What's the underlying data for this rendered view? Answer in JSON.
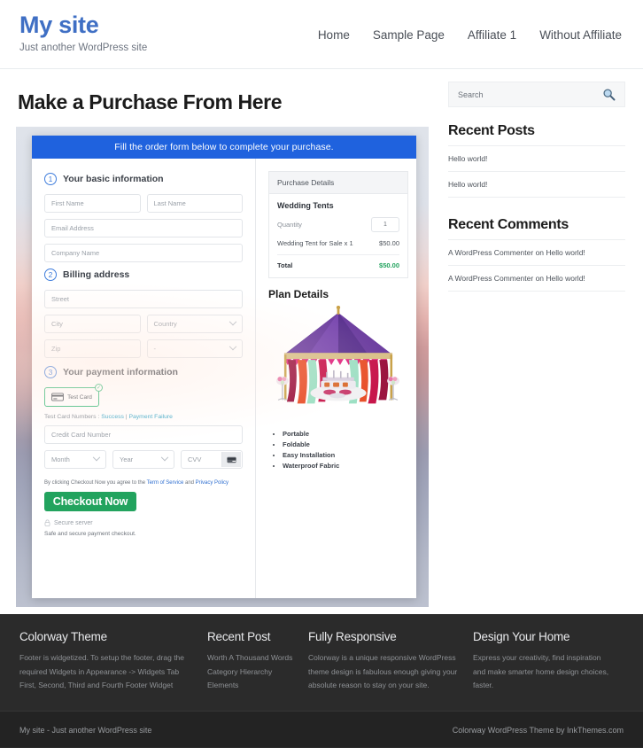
{
  "header": {
    "site_title": "My site",
    "tagline": "Just another WordPress site",
    "nav": [
      {
        "label": "Home"
      },
      {
        "label": "Sample Page"
      },
      {
        "label": "Affiliate 1"
      },
      {
        "label": "Without Affiliate"
      }
    ]
  },
  "main": {
    "page_title": "Make a Purchase From Here",
    "banner": "Fill the order form below to complete your purchase.",
    "steps": {
      "one": {
        "num": "1",
        "label": "Your basic information"
      },
      "two": {
        "num": "2",
        "label": "Billing address"
      },
      "three": {
        "num": "3",
        "label": "Your payment information"
      }
    },
    "fields": {
      "first_name": "First Name",
      "last_name": "Last Name",
      "email": "Email Address",
      "company": "Company Name",
      "street": "Street",
      "city": "City",
      "country": "Country",
      "zip": "Zip",
      "state": "-",
      "credit_card": "Credit Card Number",
      "month": "Month",
      "year": "Year",
      "cvv": "CVV"
    },
    "payment": {
      "card_option_label": "Test Card",
      "card_check_glyph": "✓",
      "testcard_prefix": "Test Card Numbers : ",
      "testcard_success": "Success",
      "testcard_divider": " | ",
      "testcard_failure": "Payment Failure",
      "agree_prefix": "By clicking Checkout Now you agree to the ",
      "agree_tos": "Term of Service",
      "agree_and": " and ",
      "agree_privacy": "Privacy Policy",
      "checkout_label": "Checkout Now",
      "secure_server": "Secure server",
      "safe_note": "Safe and secure payment checkout."
    },
    "purchase": {
      "panel_title": "Purchase Details",
      "product": "Wedding Tents",
      "quantity_label": "Quantity",
      "quantity_value": "1",
      "line_item_label": "Wedding Tent for Sale x 1",
      "line_item_price": "$50.00",
      "total_label": "Total",
      "total_value": "$50.00",
      "total_color": "#22a35e"
    },
    "plan": {
      "title": "Plan Details",
      "features": [
        "Portable",
        "Foldable",
        "Easy Installation",
        "Waterproof Fabric"
      ]
    }
  },
  "sidebar": {
    "search_placeholder": "Search",
    "recent_posts_title": "Recent Posts",
    "recent_posts": [
      {
        "label": "Hello world!"
      },
      {
        "label": "Hello world!"
      }
    ],
    "recent_comments_title": "Recent Comments",
    "recent_comments": [
      {
        "label": "A WordPress Commenter on Hello world!"
      },
      {
        "label": "A WordPress Commenter on Hello world!"
      }
    ]
  },
  "footer": {
    "columns": [
      {
        "title": "Colorway Theme",
        "text": "Footer is widgetized. To setup the footer, drag the required Widgets in Appearance -> Widgets Tab First, Second, Third and Fourth Footer Widget"
      },
      {
        "title": "Recent Post",
        "items": [
          {
            "label": "Worth A Thousand Words"
          },
          {
            "label": "Category Hierarchy"
          },
          {
            "label": "Elements"
          }
        ]
      },
      {
        "title": "Fully Responsive",
        "text": "Colorway is a unique responsive WordPress theme design is fabulous enough giving your absolute reason to stay on your site."
      },
      {
        "title": "Design Your Home",
        "text": "Express your creativity, find inspiration and make smarter home design choices, faster."
      }
    ],
    "bottom_left": "My site - Just another WordPress site",
    "bottom_right": "Colorway WordPress Theme by InkThemes.com"
  }
}
